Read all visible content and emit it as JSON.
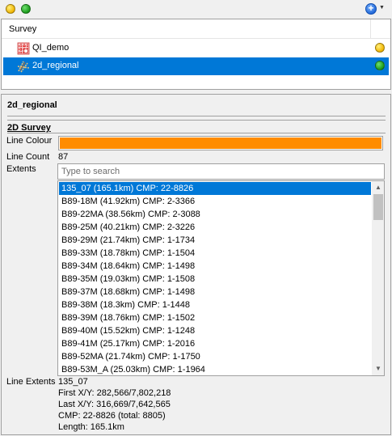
{
  "toolbar": {
    "left_dots": [
      {
        "color": "yellow"
      },
      {
        "color": "green"
      }
    ],
    "add_button": {
      "symbol": "+",
      "dropdown": "▼"
    }
  },
  "tree": {
    "column_header": "Survey",
    "rows": [
      {
        "label": "QI_demo",
        "icon": "3d-survey-icon",
        "status": "yellow",
        "selected": false
      },
      {
        "label": "2d_regional",
        "icon": "2d-survey-icon",
        "status": "green",
        "selected": true
      }
    ]
  },
  "details": {
    "title": "2d_regional",
    "section_title": "2D Survey",
    "line_colour_label": "Line Colour",
    "line_colour": "#ff8c00",
    "line_count_label": "Line Count",
    "line_count": "87",
    "extents_label": "Extents",
    "search_placeholder": "Type to search",
    "lines": [
      "135_07 (165.1km) CMP: 22-8826",
      "B89-18M (41.92km) CMP: 2-3366",
      "B89-22MA (38.56km) CMP: 2-3088",
      "B89-25M (40.21km) CMP: 2-3226",
      "B89-29M (21.74km) CMP: 1-1734",
      "B89-33M (18.78km) CMP: 1-1504",
      "B89-34M (18.64km) CMP: 1-1498",
      "B89-35M (19.03km) CMP: 1-1508",
      "B89-37M (18.68km) CMP: 1-1498",
      "B89-38M (18.3km) CMP: 1-1448",
      "B89-39M (18.76km) CMP: 1-1502",
      "B89-40M (15.52km) CMP: 1-1248",
      "B89-41M (25.17km) CMP: 1-2016",
      "B89-52MA (21.74km) CMP: 1-1750",
      "B89-53M_A (25.03km) CMP: 1-1964"
    ],
    "selected_line_index": 0,
    "line_extents_label": "Line Extents",
    "line_extents": [
      "135_07",
      "First X/Y: 282,566/7,802,218",
      "Last X/Y: 316,669/7,642,565",
      "CMP: 22-8826 (total: 8805)",
      "Length: 165.1km"
    ]
  }
}
